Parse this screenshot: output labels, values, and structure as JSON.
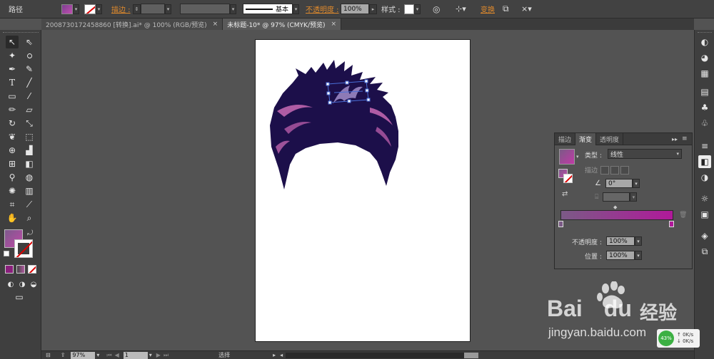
{
  "control_bar": {
    "object_type": "路径",
    "stroke_label": "描边 :",
    "stroke_profile": "基本",
    "opacity_label": "不透明度 :",
    "opacity_value": "100%",
    "style_label": "样式 :",
    "transform_label": "变换",
    "fill_icon": "gradient-swatch",
    "stroke_icon": "none-swatch"
  },
  "tabs": [
    {
      "label": "2008730172458860 [转换].ai* @ 100% (RGB/预览)",
      "close": "×"
    },
    {
      "label": "未标题-10* @ 97% (CMYK/预览)",
      "close": "×"
    }
  ],
  "gradient_panel": {
    "tabs": [
      "描边",
      "渐变",
      "透明度"
    ],
    "collapse_glyph": "▸▸",
    "menu_glyph": "≡",
    "type_label": "类型 :",
    "type_value": "线性",
    "stroke_label": "描边",
    "angle_value": "0°",
    "opacity_label": "不透明度 :",
    "opacity_value": "100%",
    "location_label": "位置 :",
    "location_value": "100%",
    "gradient_start": "#7b5a86",
    "gradient_end": "#b0199a"
  },
  "status_bar": {
    "zoom": "97%",
    "page": "1",
    "mode": "选择"
  },
  "watermark": {
    "brand_text": "Bai",
    "brand_text2": "du",
    "cn_text": "经验",
    "url": "jingyan.baidu.com"
  },
  "network": {
    "up": "0K/s",
    "down": "0K/s",
    "percent": "43%"
  },
  "colors": {
    "hair_fill": "#1c0f4a",
    "hair_highlight": "#c86ab4",
    "selection": "#4a6fd8",
    "accent_orange": "#e08a2c"
  }
}
